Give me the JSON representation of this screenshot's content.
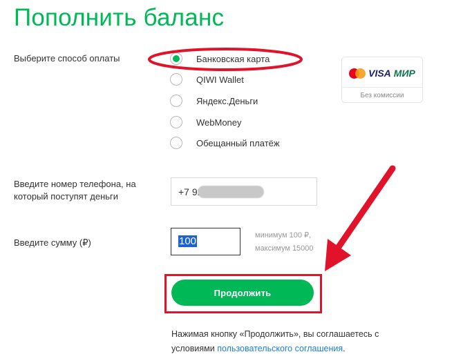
{
  "page": {
    "title": "Пополнить баланс"
  },
  "payment": {
    "label": "Выберите способ оплаты",
    "options": [
      {
        "label": "Банковская карта",
        "selected": true
      },
      {
        "label": "QIWI Wallet",
        "selected": false
      },
      {
        "label": "Яндекс.Деньги",
        "selected": false
      },
      {
        "label": "WebMoney",
        "selected": false
      },
      {
        "label": "Обещанный платёж",
        "selected": false
      }
    ],
    "cards": {
      "logos": [
        "mastercard-icon",
        "visa-icon",
        "mir-icon"
      ],
      "visa_text": "VISA",
      "mir_text": "МИР",
      "note": "Без комиссии"
    }
  },
  "phone": {
    "label_line1": "Введите номер телефона, на",
    "label_line2": "который поступят деньги",
    "value": "+7 92"
  },
  "amount": {
    "label": "Введите сумму (₽)",
    "value": "100",
    "hint_min": "минимум 100 ₽,",
    "hint_max": "максимум 15000"
  },
  "actions": {
    "continue_label": "Продолжить"
  },
  "terms": {
    "text_line1": "Нажимая кнопку «Продолжить», вы соглашаетесь с",
    "text_line2_prefix": "условиями ",
    "link_text": "пользовательского соглашения",
    "text_line2_suffix": "."
  },
  "colors": {
    "brand_green": "#00b956",
    "annotation_red": "#e0132a",
    "link_blue": "#1a7fd6",
    "selection_blue": "#1c63d1"
  }
}
